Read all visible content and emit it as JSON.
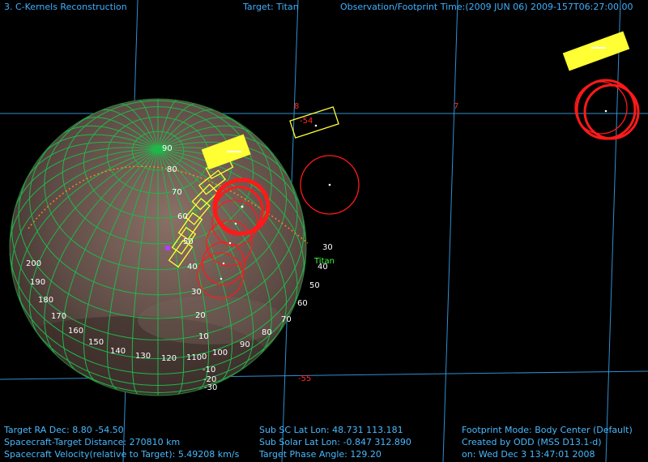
{
  "header": {
    "window_title": "3. C-Kernels Reconstruction",
    "target": "Target: Titan",
    "observation_time": "Observation/Footprint Time:(2009 JUN 06) 2009-157T06:27:00.00"
  },
  "grid_labels": {
    "ra_8": "8",
    "ra_7": "7",
    "dec_minus54": "-54",
    "dec_minus55": "-55"
  },
  "body_label": "Titan",
  "latitude_labels": [
    "90",
    "80",
    "70",
    "60",
    "50",
    "40",
    "30",
    "20",
    "10",
    "0",
    "-10",
    "-20",
    "-30"
  ],
  "longitude_labels_left": [
    "200",
    "190",
    "180",
    "170",
    "160",
    "150",
    "140",
    "130",
    "120",
    "110"
  ],
  "longitude_labels_right": [
    "100",
    "90",
    "80",
    "70",
    "60",
    "50",
    "40",
    "30"
  ],
  "footer": {
    "left": [
      "Target RA Dec:  8.80  -54.50",
      "Spacecraft-Target Distance:  270810 km",
      "Spacecraft Velocity(relative to Target): 5.49208 km/s"
    ],
    "middle": [
      "Sub SC Lat Lon: 48.731  113.181",
      "Sub Solar Lat Lon: -0.847  312.890",
      "Target Phase Angle: 129.20"
    ],
    "right": [
      "Footprint Mode: Body Center (Default)",
      "Created by ODD (MSS D13.1-d)",
      "on: Wed Dec  3 13:47:01 2008"
    ]
  },
  "colors": {
    "background": "#000000",
    "sky_grid": "#2f8fd0",
    "planet_grid": "#1fb84a",
    "footprint_rect": "#ffff33",
    "footprint_circle": "#ff1a1a",
    "info_text": "#48b8ff",
    "body_label": "#40ff40"
  }
}
